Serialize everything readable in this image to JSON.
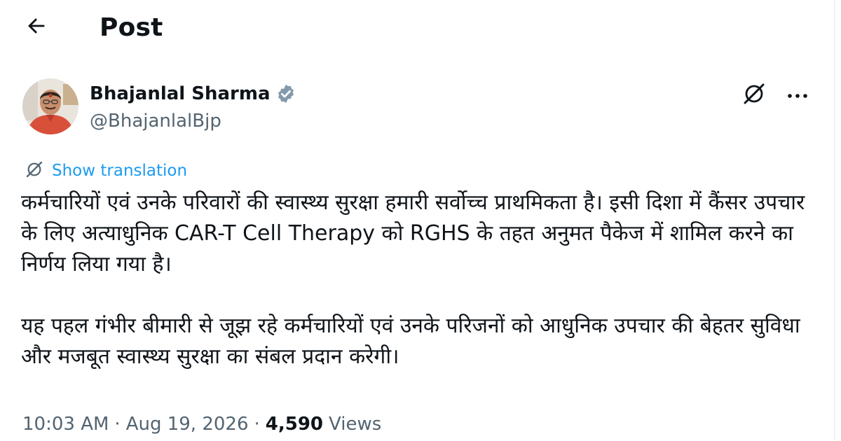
{
  "header": {
    "title": "Post"
  },
  "author": {
    "name": "Bhajanlal Sharma",
    "handle": "@BhajanlalBjp",
    "verified": true,
    "verified_color": "#829aab"
  },
  "translation": {
    "label": "Show translation"
  },
  "post": {
    "paragraph_1": "कर्मचारियों एवं उनके परिवारों की स्वास्थ्य सुरक्षा हमारी सर्वोच्च प्राथमिकता है। इसी दिशा में कैंसर उपचार के लिए अत्याधुनिक CAR-T Cell Therapy को RGHS के तहत अनुमत पैकेज में शामिल करने का निर्णय लिया गया है।",
    "paragraph_2": "यह पहल गंभीर बीमारी से जूझ रहे कर्मचारियों एवं उनके परिजनों को आधुनिक उपचार की बेहतर सुविधा और मजबूत स्वास्थ्य सुरक्षा का संबल प्रदान करेगी।"
  },
  "meta": {
    "time": "10:03 AM",
    "date": "Aug 19, 2026",
    "separator": "·",
    "views_count": "4,590",
    "views_label": "Views"
  },
  "icons": {
    "back": "arrow-left-icon",
    "verified": "verified-badge-icon",
    "grok": "grok-icon",
    "more": "more-icon",
    "translate": "translate-icon"
  },
  "colors": {
    "text": "#0f1419",
    "muted": "#536471",
    "link": "#1d9bf0"
  }
}
